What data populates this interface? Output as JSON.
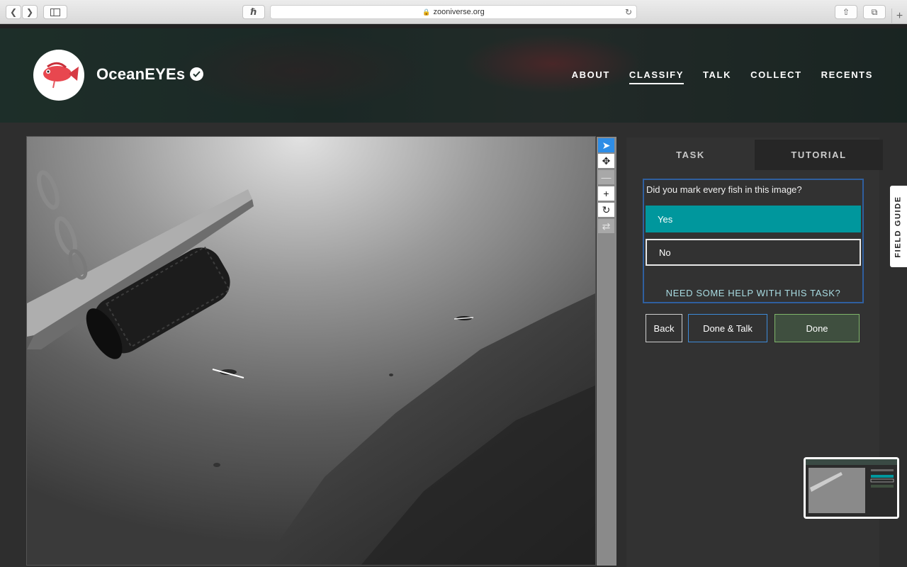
{
  "browser": {
    "url": "zooniverse.org",
    "icons": [
      "chevron-left-icon",
      "chevron-right-icon",
      "sidebar-icon",
      "extension-icon",
      "lock-icon",
      "reload-icon",
      "share-icon",
      "tabs-icon",
      "plus-icon"
    ]
  },
  "header": {
    "title": "OceanEYEs",
    "nav": [
      "ABOUT",
      "CLASSIFY",
      "TALK",
      "COLLECT",
      "RECENTS"
    ],
    "active_nav": "CLASSIFY"
  },
  "viewer": {
    "tools": [
      "pointer-icon",
      "move-icon",
      "zoom-out-icon",
      "zoom-in-icon",
      "rotate-icon",
      "reset-icon"
    ]
  },
  "task": {
    "tabs": [
      "TASK",
      "TUTORIAL"
    ],
    "question": "Did you mark every fish in this image?",
    "answers": [
      "Yes",
      "No"
    ],
    "selected_answer": "Yes",
    "help": "NEED SOME HELP WITH THIS TASK?",
    "buttons": {
      "back": "Back",
      "done_talk": "Done & Talk",
      "done": "Done"
    }
  },
  "field_guide": "FIELD GUIDE",
  "colors": {
    "accent_teal": "#00979d",
    "selected_tool": "#2e8de6",
    "task_border": "#2f5f9f",
    "done_border": "#7fb56a"
  }
}
